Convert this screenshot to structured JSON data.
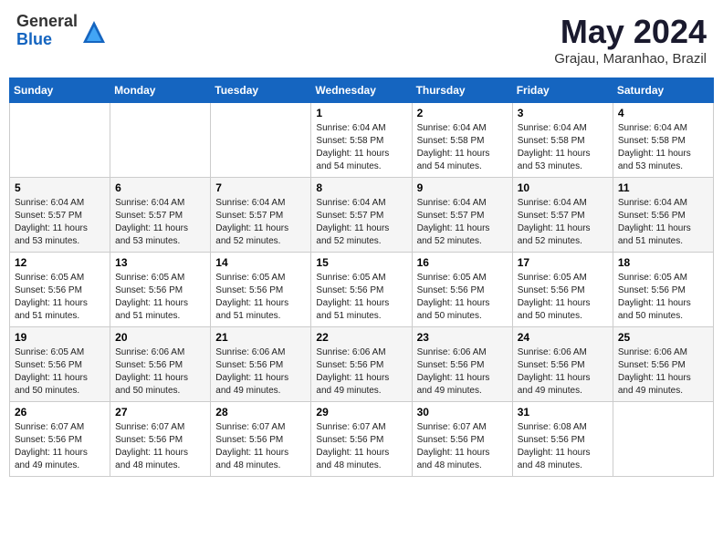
{
  "header": {
    "logo_general": "General",
    "logo_blue": "Blue",
    "month_year": "May 2024",
    "location": "Grajau, Maranhao, Brazil"
  },
  "days_of_week": [
    "Sunday",
    "Monday",
    "Tuesday",
    "Wednesday",
    "Thursday",
    "Friday",
    "Saturday"
  ],
  "weeks": [
    [
      {
        "day": "",
        "info": ""
      },
      {
        "day": "",
        "info": ""
      },
      {
        "day": "",
        "info": ""
      },
      {
        "day": "1",
        "info": "Sunrise: 6:04 AM\nSunset: 5:58 PM\nDaylight: 11 hours\nand 54 minutes."
      },
      {
        "day": "2",
        "info": "Sunrise: 6:04 AM\nSunset: 5:58 PM\nDaylight: 11 hours\nand 54 minutes."
      },
      {
        "day": "3",
        "info": "Sunrise: 6:04 AM\nSunset: 5:58 PM\nDaylight: 11 hours\nand 53 minutes."
      },
      {
        "day": "4",
        "info": "Sunrise: 6:04 AM\nSunset: 5:58 PM\nDaylight: 11 hours\nand 53 minutes."
      }
    ],
    [
      {
        "day": "5",
        "info": "Sunrise: 6:04 AM\nSunset: 5:57 PM\nDaylight: 11 hours\nand 53 minutes."
      },
      {
        "day": "6",
        "info": "Sunrise: 6:04 AM\nSunset: 5:57 PM\nDaylight: 11 hours\nand 53 minutes."
      },
      {
        "day": "7",
        "info": "Sunrise: 6:04 AM\nSunset: 5:57 PM\nDaylight: 11 hours\nand 52 minutes."
      },
      {
        "day": "8",
        "info": "Sunrise: 6:04 AM\nSunset: 5:57 PM\nDaylight: 11 hours\nand 52 minutes."
      },
      {
        "day": "9",
        "info": "Sunrise: 6:04 AM\nSunset: 5:57 PM\nDaylight: 11 hours\nand 52 minutes."
      },
      {
        "day": "10",
        "info": "Sunrise: 6:04 AM\nSunset: 5:57 PM\nDaylight: 11 hours\nand 52 minutes."
      },
      {
        "day": "11",
        "info": "Sunrise: 6:04 AM\nSunset: 5:56 PM\nDaylight: 11 hours\nand 51 minutes."
      }
    ],
    [
      {
        "day": "12",
        "info": "Sunrise: 6:05 AM\nSunset: 5:56 PM\nDaylight: 11 hours\nand 51 minutes."
      },
      {
        "day": "13",
        "info": "Sunrise: 6:05 AM\nSunset: 5:56 PM\nDaylight: 11 hours\nand 51 minutes."
      },
      {
        "day": "14",
        "info": "Sunrise: 6:05 AM\nSunset: 5:56 PM\nDaylight: 11 hours\nand 51 minutes."
      },
      {
        "day": "15",
        "info": "Sunrise: 6:05 AM\nSunset: 5:56 PM\nDaylight: 11 hours\nand 51 minutes."
      },
      {
        "day": "16",
        "info": "Sunrise: 6:05 AM\nSunset: 5:56 PM\nDaylight: 11 hours\nand 50 minutes."
      },
      {
        "day": "17",
        "info": "Sunrise: 6:05 AM\nSunset: 5:56 PM\nDaylight: 11 hours\nand 50 minutes."
      },
      {
        "day": "18",
        "info": "Sunrise: 6:05 AM\nSunset: 5:56 PM\nDaylight: 11 hours\nand 50 minutes."
      }
    ],
    [
      {
        "day": "19",
        "info": "Sunrise: 6:05 AM\nSunset: 5:56 PM\nDaylight: 11 hours\nand 50 minutes."
      },
      {
        "day": "20",
        "info": "Sunrise: 6:06 AM\nSunset: 5:56 PM\nDaylight: 11 hours\nand 50 minutes."
      },
      {
        "day": "21",
        "info": "Sunrise: 6:06 AM\nSunset: 5:56 PM\nDaylight: 11 hours\nand 49 minutes."
      },
      {
        "day": "22",
        "info": "Sunrise: 6:06 AM\nSunset: 5:56 PM\nDaylight: 11 hours\nand 49 minutes."
      },
      {
        "day": "23",
        "info": "Sunrise: 6:06 AM\nSunset: 5:56 PM\nDaylight: 11 hours\nand 49 minutes."
      },
      {
        "day": "24",
        "info": "Sunrise: 6:06 AM\nSunset: 5:56 PM\nDaylight: 11 hours\nand 49 minutes."
      },
      {
        "day": "25",
        "info": "Sunrise: 6:06 AM\nSunset: 5:56 PM\nDaylight: 11 hours\nand 49 minutes."
      }
    ],
    [
      {
        "day": "26",
        "info": "Sunrise: 6:07 AM\nSunset: 5:56 PM\nDaylight: 11 hours\nand 49 minutes."
      },
      {
        "day": "27",
        "info": "Sunrise: 6:07 AM\nSunset: 5:56 PM\nDaylight: 11 hours\nand 48 minutes."
      },
      {
        "day": "28",
        "info": "Sunrise: 6:07 AM\nSunset: 5:56 PM\nDaylight: 11 hours\nand 48 minutes."
      },
      {
        "day": "29",
        "info": "Sunrise: 6:07 AM\nSunset: 5:56 PM\nDaylight: 11 hours\nand 48 minutes."
      },
      {
        "day": "30",
        "info": "Sunrise: 6:07 AM\nSunset: 5:56 PM\nDaylight: 11 hours\nand 48 minutes."
      },
      {
        "day": "31",
        "info": "Sunrise: 6:08 AM\nSunset: 5:56 PM\nDaylight: 11 hours\nand 48 minutes."
      },
      {
        "day": "",
        "info": ""
      }
    ]
  ]
}
